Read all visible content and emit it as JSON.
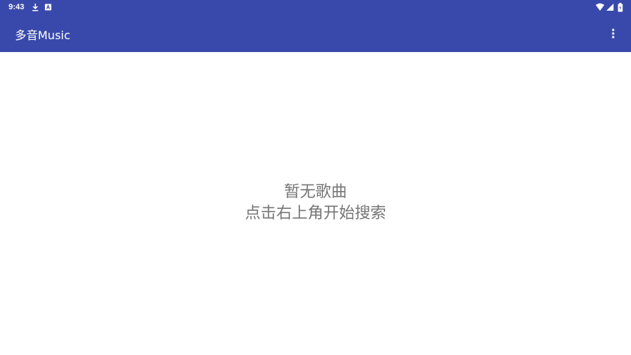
{
  "status_bar": {
    "time": "9:43",
    "icons": [
      "download-icon",
      "notification-a-icon",
      "wifi-icon",
      "signal-icon",
      "battery-icon"
    ]
  },
  "app_bar": {
    "title": "多音Music",
    "overflow_icon": "more-vert-icon"
  },
  "empty_state": {
    "line1": "暂无歌曲",
    "line2": "点击右上角开始搜索"
  },
  "colors": {
    "primary": "#3949ab",
    "background": "#ffffff",
    "empty_text": "#757575"
  }
}
